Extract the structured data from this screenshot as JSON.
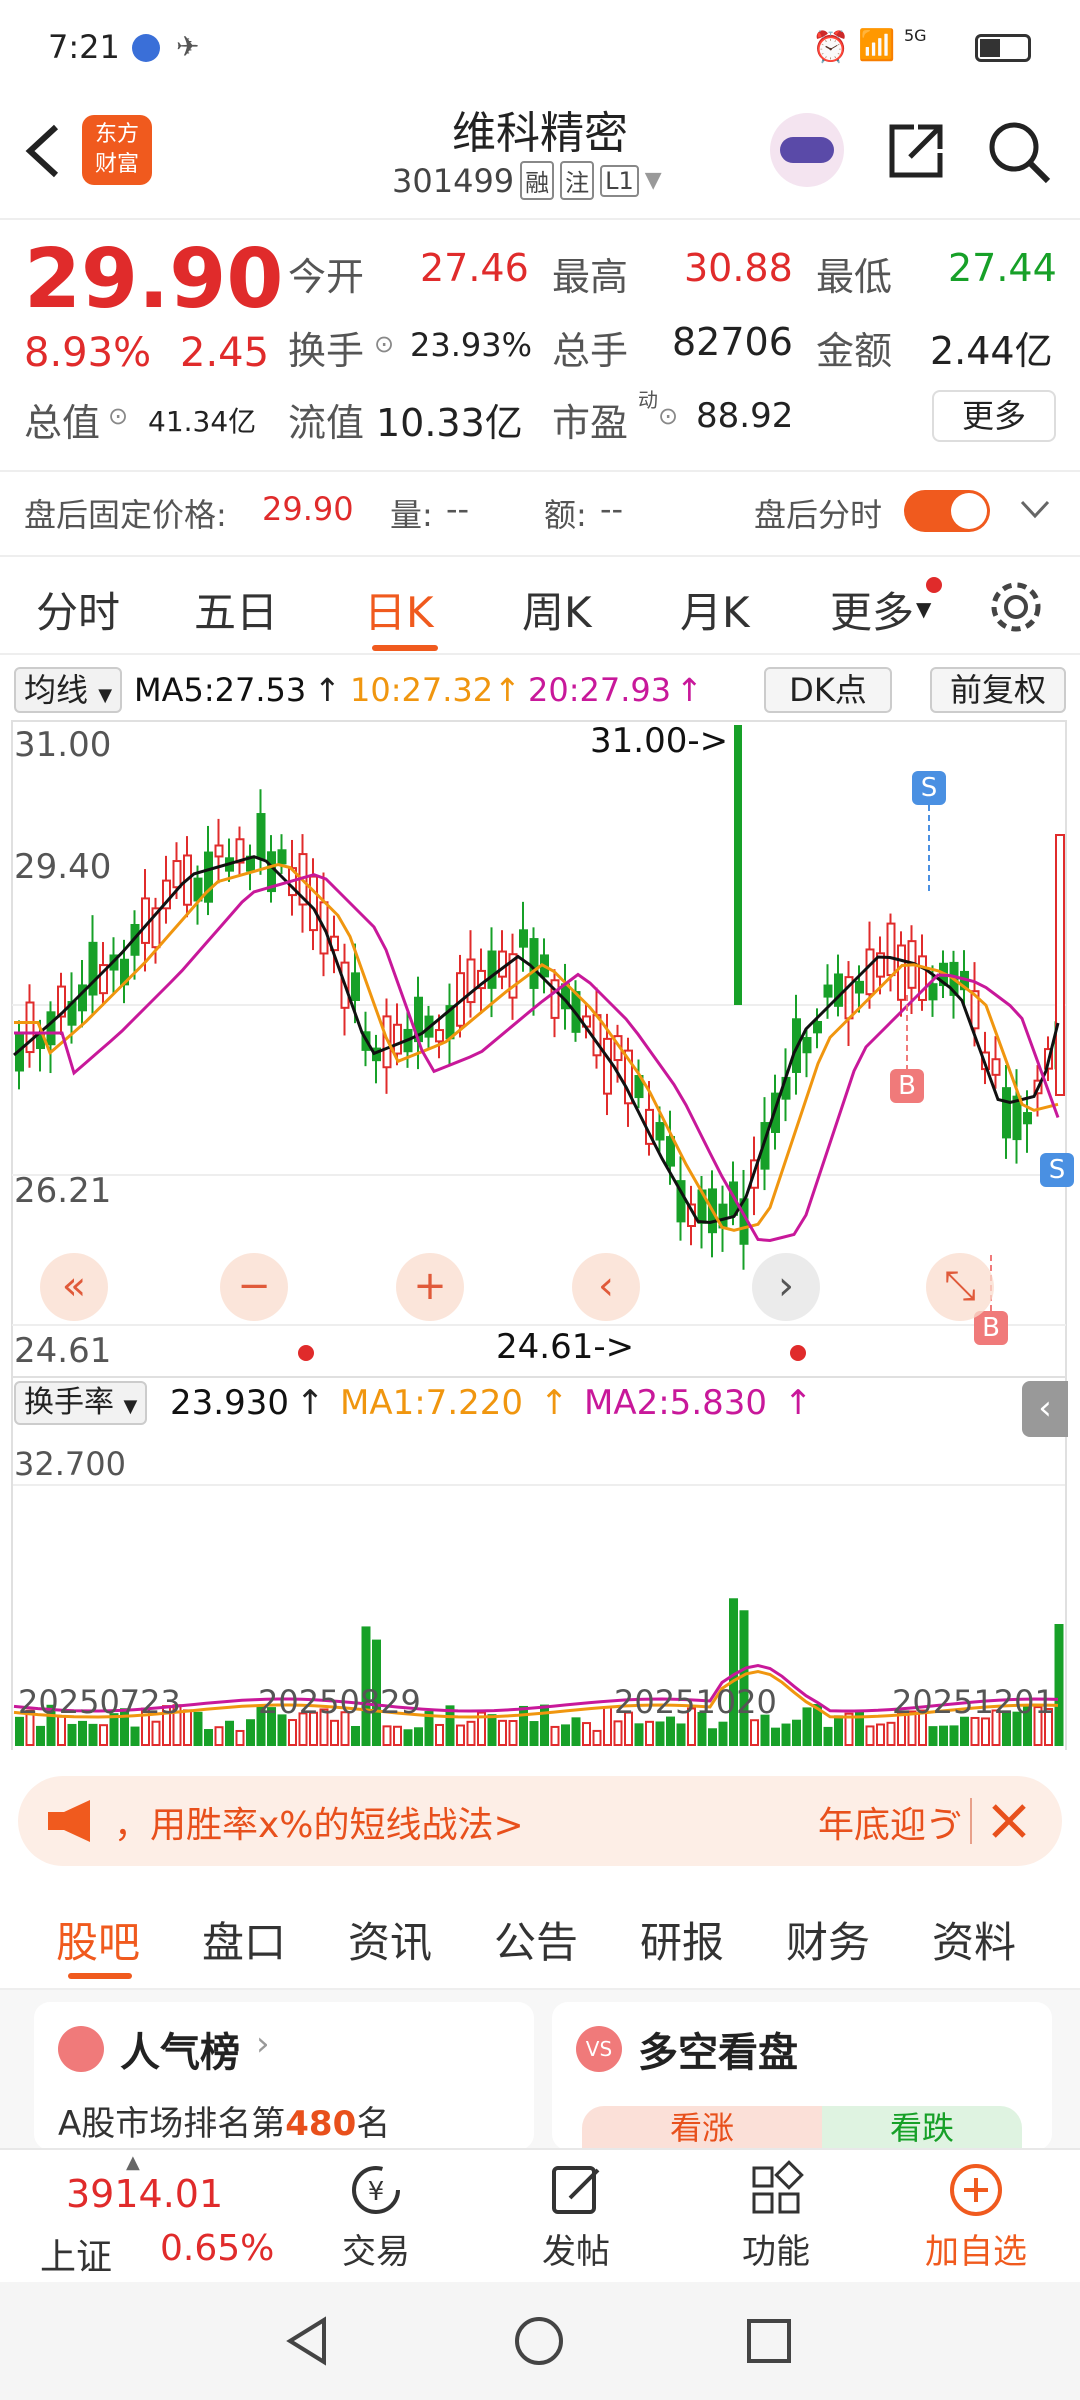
{
  "status_bar": {
    "time": "7:21",
    "network": "5G"
  },
  "header": {
    "logo_line1": "东方",
    "logo_line2": "财富",
    "stock_name": "维科精密",
    "stock_code": "301499",
    "tags": [
      "融",
      "注",
      "L1"
    ]
  },
  "quote": {
    "price": "29.90",
    "change_pct": "8.93%",
    "change_amt": "2.45",
    "open_label": "今开",
    "open": "27.46",
    "high_label": "最高",
    "high": "30.88",
    "low_label": "最低",
    "low": "27.44",
    "turnover_label": "换手",
    "turnover": "23.93%",
    "volume_label": "总手",
    "volume": "82706",
    "amount_label": "金额",
    "amount": "2.44亿",
    "mcap_label": "总值",
    "mcap": "41.34亿",
    "float_label": "流值",
    "float_value": "10.33亿",
    "pe_label": "市盈",
    "pe_sup": "动",
    "pe": "88.92",
    "more_button": "更多",
    "after_label": "盘后固定价格:",
    "after_price": "29.90",
    "after_vol_label": "量:",
    "after_vol": "--",
    "after_amt_label": "额:",
    "after_amt": "--",
    "after_toggle_label": "盘后分时"
  },
  "chart_tabs": [
    "分时",
    "五日",
    "日K",
    "周K",
    "月K",
    "更多"
  ],
  "active_tab": "日K",
  "kchart": {
    "ma_selector": "均线",
    "ma5": "MA5:27.53",
    "ma10": "10:27.32",
    "ma20": "20:27.93",
    "dk_button": "DK点",
    "fq_button": "前复权",
    "y_labels": [
      "31.00",
      "29.40",
      "26.21",
      "24.61"
    ],
    "max_annot": "31.00->",
    "min_annot": "24.61->",
    "sig_buy": "B",
    "sig_sell": "S"
  },
  "volchart": {
    "selector": "换手率",
    "value": "23.930",
    "ma1": "MA1:7.220",
    "ma2": "MA2:5.830",
    "top_label": "32.700",
    "dates": [
      "20250723",
      "20250829",
      "20251020",
      "20251201"
    ]
  },
  "colors": {
    "up": "#e02b2b",
    "down": "#17a028",
    "ma5": "#111111",
    "ma10": "#f0960f",
    "ma20": "#c8189a",
    "accent": "#f05a1e"
  },
  "promo": {
    "text": "，用胜率x%的短线战法>",
    "right_text": "年底迎ゔ"
  },
  "sub_tabs": [
    "股吧",
    "盘口",
    "资讯",
    "公告",
    "研报",
    "财务",
    "资料"
  ],
  "cards": {
    "popularity_title": "人气榜",
    "popularity_text": "A股市场排名第",
    "popularity_rank": "480",
    "popularity_unit": "名",
    "duokong_title": "多空看盘",
    "bull": "看涨",
    "bear": "看跌"
  },
  "bottom": {
    "index_value": "3914.01",
    "index_name": "上证",
    "index_change": "0.65%",
    "trade": "交易",
    "post": "发帖",
    "func": "功能",
    "add": "加自选"
  }
}
